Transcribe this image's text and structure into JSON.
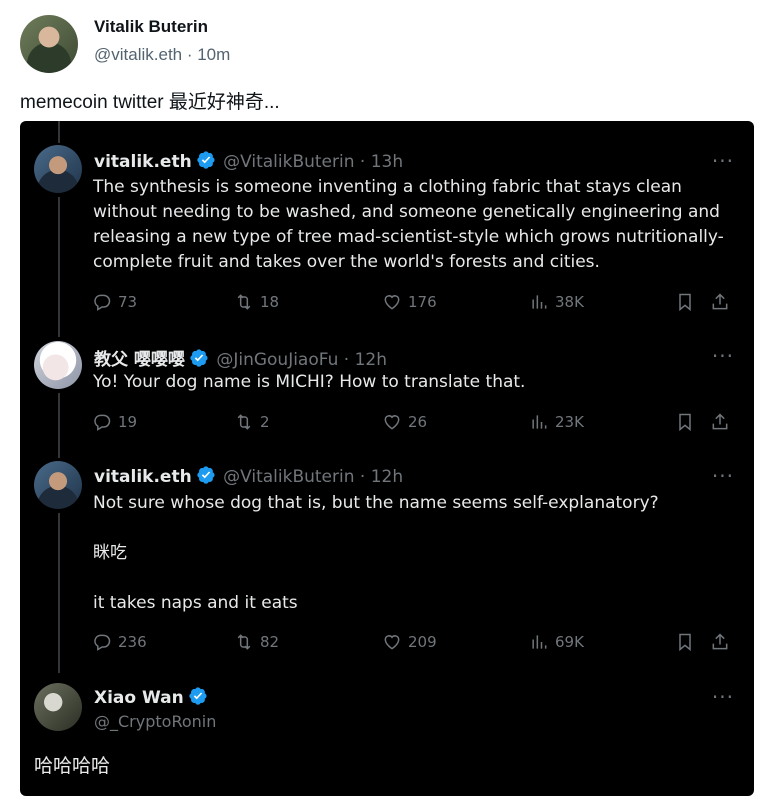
{
  "outer_post": {
    "author_name": "Vitalik Buterin",
    "meta": "@vitalik.eth · 10m",
    "text": "memecoin twitter 最近好神奇..."
  },
  "embedded_thread": [
    {
      "name": "vitalik.eth",
      "handle_time": "@VitalikButerin · 13h",
      "body": "The synthesis is someone inventing a clothing fabric that stays clean\nwithout needing to be washed, and someone genetically engineering and\nreleasing a new type of tree mad-scientist-style which grows nutritionally-\ncomplete fruit and takes over the world's forests and cities.",
      "replies": "73",
      "retweets": "18",
      "likes": "176",
      "views": "38K"
    },
    {
      "name": "教父 嘤嘤嘤",
      "handle_time": "@JinGouJiaoFu · 12h",
      "body": "Yo! Your dog name is MICHI? How to translate that.",
      "replies": "19",
      "retweets": "2",
      "likes": "26",
      "views": "23K"
    },
    {
      "name": "vitalik.eth",
      "handle_time": "@VitalikButerin · 12h",
      "body": "Not sure whose dog that is, but the name seems self-explanatory?\n\n眯吃\n\nit takes naps and it eats",
      "replies": "236",
      "retweets": "82",
      "likes": "209",
      "views": "69K"
    },
    {
      "name": "Xiao Wan",
      "handle": "@_CryptoRonin",
      "body": "哈哈哈哈"
    }
  ],
  "more_label": "···",
  "colors": {
    "verified": "#1d9bf0",
    "embed_bg": "#000000",
    "muted": "#71767b"
  }
}
